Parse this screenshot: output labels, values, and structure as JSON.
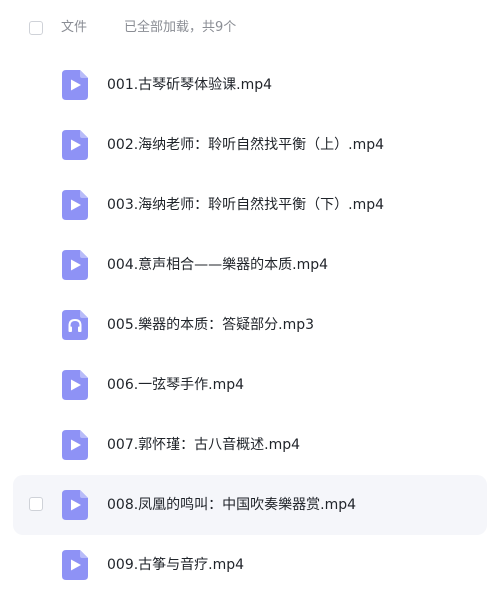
{
  "header": {
    "column_label": "文件",
    "status_text": "已全部加载，共9个"
  },
  "colors": {
    "icon_fill": "#8e92f5",
    "hover_background": "#f5f6fa"
  },
  "files": [
    {
      "name": "001.古琴斫琴体验课.mp4",
      "icon": "video-file-icon"
    },
    {
      "name": "002.海纳老师：聆听自然找平衡（上）.mp4",
      "icon": "video-file-icon"
    },
    {
      "name": "003.海纳老师：聆听自然找平衡（下）.mp4",
      "icon": "video-file-icon"
    },
    {
      "name": "004.意声相合——樂器的本质.mp4",
      "icon": "video-file-icon"
    },
    {
      "name": "005.樂器的本质：答疑部分.mp3",
      "icon": "audio-file-icon"
    },
    {
      "name": "006.一弦琴手作.mp4",
      "icon": "video-file-icon"
    },
    {
      "name": "007.郭怀瑾：古八音概述.mp4",
      "icon": "video-file-icon"
    },
    {
      "name": "008.凤凰的鸣叫：中国吹奏樂器赏.mp4",
      "icon": "video-file-icon",
      "hovered": true
    },
    {
      "name": "009.古筝与音疗.mp4",
      "icon": "video-file-icon"
    }
  ]
}
